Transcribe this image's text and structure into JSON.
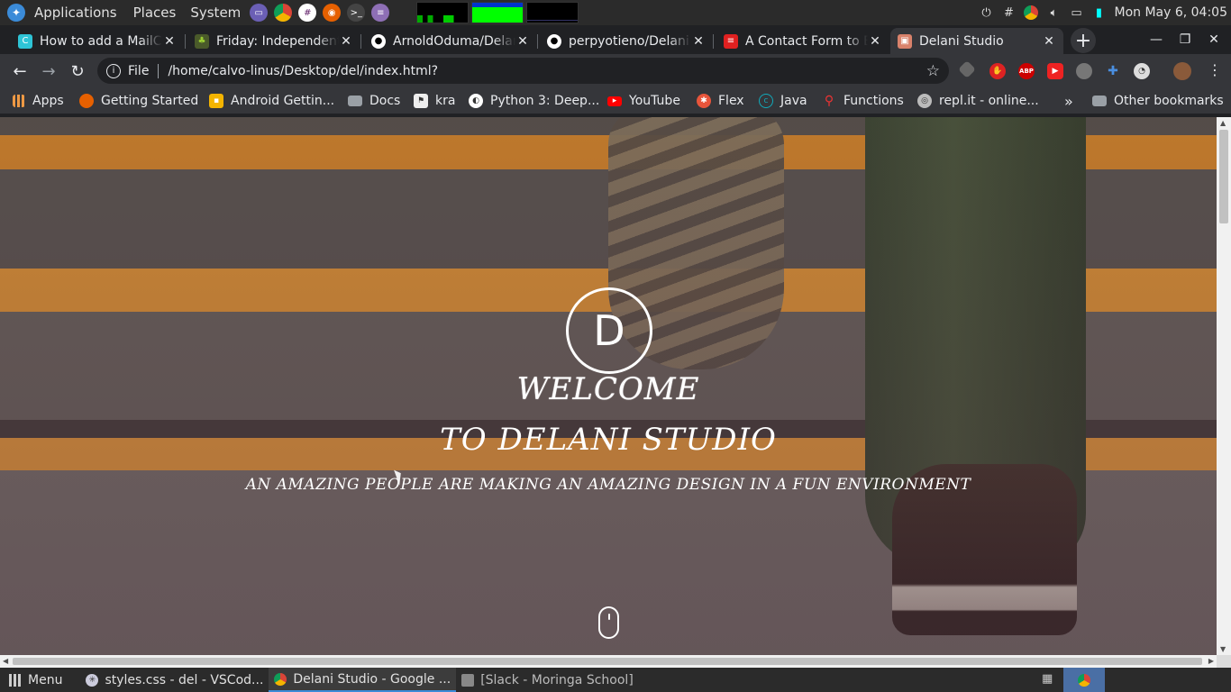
{
  "top_panel": {
    "menus": [
      "Applications",
      "Places",
      "System"
    ],
    "clock": "Mon May  6, 04:05"
  },
  "tabs": [
    {
      "title": "How to add a MailChimp",
      "favicon": "c-logo-icon",
      "color": "#2ec4d6"
    },
    {
      "title": "Friday: Independent",
      "favicon": "plant-icon",
      "color": "#6b8e23"
    },
    {
      "title": "ArnoldOduma/Delani",
      "favicon": "github-icon",
      "color": "#ffffff"
    },
    {
      "title": "perpyotieno/Delani",
      "favicon": "github-icon",
      "color": "#ffffff"
    },
    {
      "title": "A Contact Form to Email",
      "favicon": "form-icon",
      "color": "#e02020"
    },
    {
      "title": "Delani Studio",
      "favicon": "page-icon",
      "color": "#d9826b"
    }
  ],
  "toolbar": {
    "file_label": "File",
    "url": "/home/calvo-linus/Desktop/del/index.html?"
  },
  "bookmarks": [
    {
      "label": "Apps",
      "icon": "apps-grid-icon"
    },
    {
      "label": "Getting Started",
      "icon": "firefox-icon"
    },
    {
      "label": "Android Gettin...",
      "icon": "android-icon"
    },
    {
      "label": "Docs",
      "icon": "folder-icon"
    },
    {
      "label": "kra",
      "icon": "kra-icon"
    },
    {
      "label": "Python 3: Deep...",
      "icon": "globe-icon"
    },
    {
      "label": "YouTube",
      "icon": "youtube-icon"
    },
    {
      "label": "Flex",
      "icon": "flex-icon"
    },
    {
      "label": "Java",
      "icon": "java-icon"
    },
    {
      "label": "Functions",
      "icon": "functions-icon"
    },
    {
      "label": "repl.it - online...",
      "icon": "replit-icon"
    }
  ],
  "bookmarks_more": "»",
  "other_bookmarks": "Other bookmarks",
  "page": {
    "logo_letter": "D",
    "welcome": "WELCOME",
    "studio": "TO DELANI STUDIO",
    "tagline": "AN AMAZING PEOPLE ARE MAKING AN AMAZING DESIGN IN A FUN ENVIRONMENT"
  },
  "taskbar": {
    "menu_label": "Menu",
    "tasks": [
      {
        "label": "styles.css - del - VSCod...",
        "icon": "vscode-icon"
      },
      {
        "label": "Delani Studio - Google ...",
        "icon": "chrome-icon"
      },
      {
        "label": "[Slack - Moringa School]",
        "icon": "window-icon"
      }
    ]
  }
}
